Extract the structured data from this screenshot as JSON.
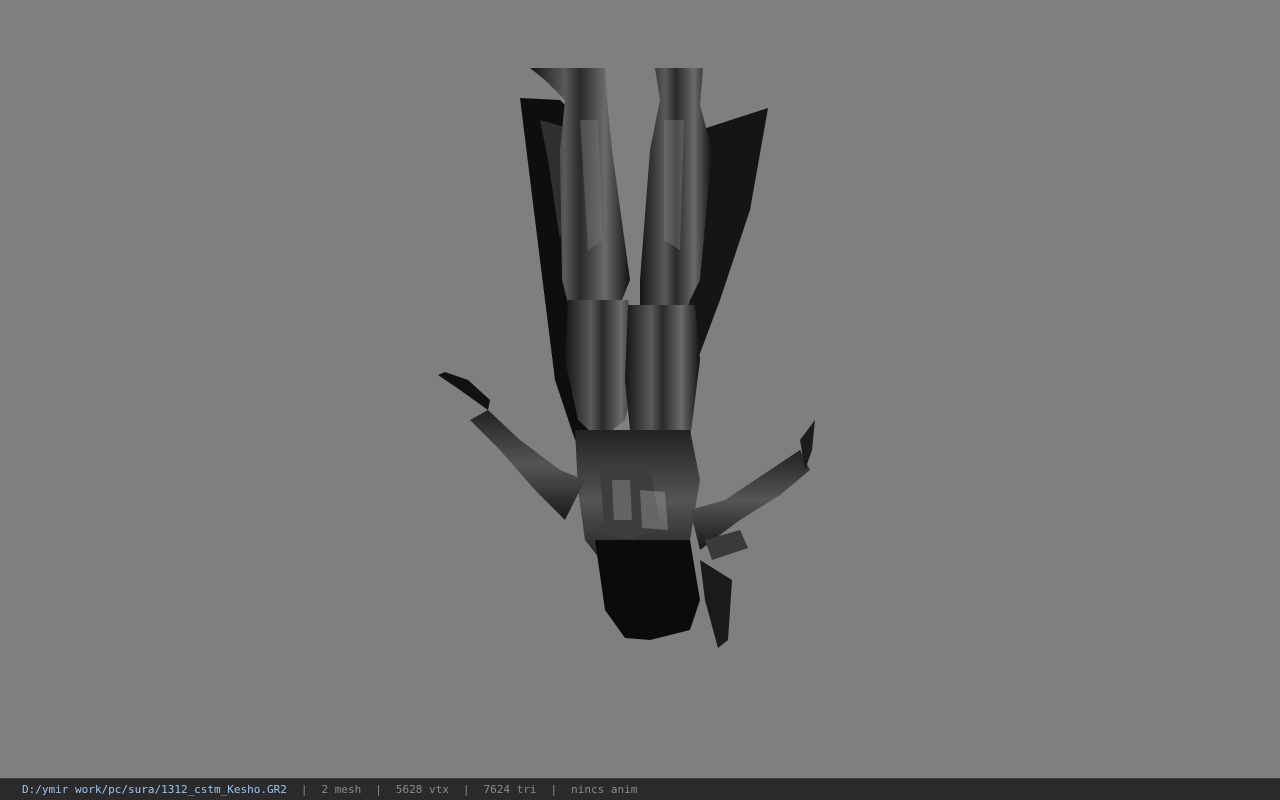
{
  "viewer": {
    "background_color": "#7f7f7f",
    "model_icon": "armored-character-model"
  },
  "status_bar": {
    "file_path": "D:/ymir work/pc/sura/1312_cstm_Kesho.GR2",
    "mesh_count": "2 mesh",
    "vertex_count": "5628 vtx",
    "triangle_count": "7624 tri",
    "anim_status": "nincs anim",
    "separator": "|"
  }
}
